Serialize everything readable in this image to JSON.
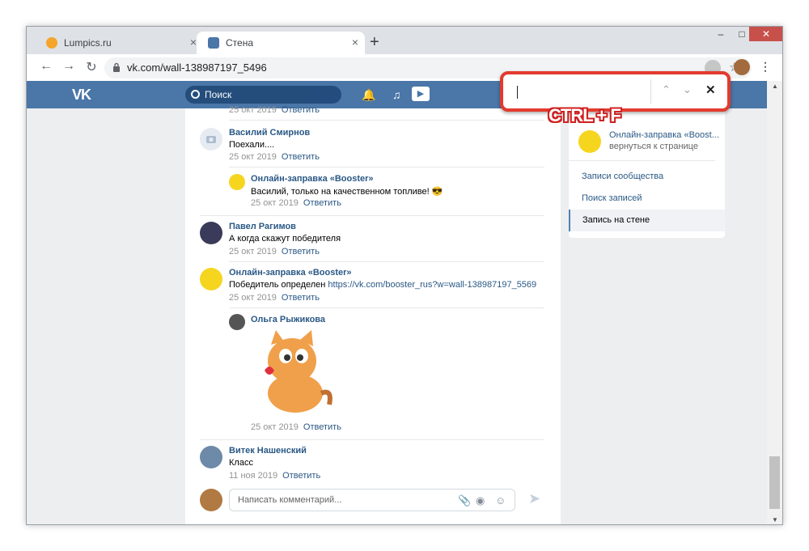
{
  "browser": {
    "tabs": [
      {
        "title": "Lumpics.ru",
        "active": false,
        "favicon_color": "#f4a52a"
      },
      {
        "title": "Стена",
        "active": true,
        "favicon_color": "#4a76a8"
      }
    ],
    "new_tab_symbol": "+",
    "tab_close_symbol": "×",
    "url": "vk.com/wall-138987197_5496"
  },
  "vk": {
    "logo": "VK",
    "search_placeholder": "Поиск"
  },
  "find_bar": {
    "value": "",
    "prev_symbol": "⌃",
    "next_symbol": "⌄",
    "close_symbol": "✕"
  },
  "overlay_label": "CTRL + F",
  "comments": [
    {
      "name": "",
      "text": "",
      "date": "25 окт 2019",
      "reply": "Ответить"
    },
    {
      "name": "Василий Смирнов",
      "text": "Поехали....",
      "date": "25 окт 2019",
      "reply": "Ответить"
    },
    {
      "name": "Онлайн-заправка «Booster»",
      "text": "Василий, только на качественном топливе! 😎",
      "date": "25 окт 2019",
      "reply": "Ответить"
    },
    {
      "name": "Павел Рагимов",
      "text": "А когда скажут победителя",
      "date": "25 окт 2019",
      "reply": "Ответить"
    },
    {
      "name": "Онлайн-заправка «Booster»",
      "text": "Победитель определен ",
      "link": "https://vk.com/booster_rus?w=wall-138987197_5569",
      "date": "25 окт 2019",
      "reply": "Ответить"
    },
    {
      "name": "Ольга Рыжикова",
      "text": "",
      "date": "25 окт 2019",
      "reply": "Ответить"
    },
    {
      "name": "Витек Нашенский",
      "text": "Класс",
      "date": "11 ноя 2019",
      "reply": "Ответить"
    }
  ],
  "comment_input": {
    "placeholder": "Написать комментарий..."
  },
  "right_column": {
    "group_name": "Онлайн-заправка «Boost...",
    "back_text": "вернуться к странице",
    "links": [
      "Записи сообщества",
      "Поиск записей"
    ],
    "active_link": "Запись на стене"
  },
  "colors": {
    "vk_blue": "#4a76a8",
    "link": "#2a5885",
    "highlight": "#e23b2e"
  }
}
